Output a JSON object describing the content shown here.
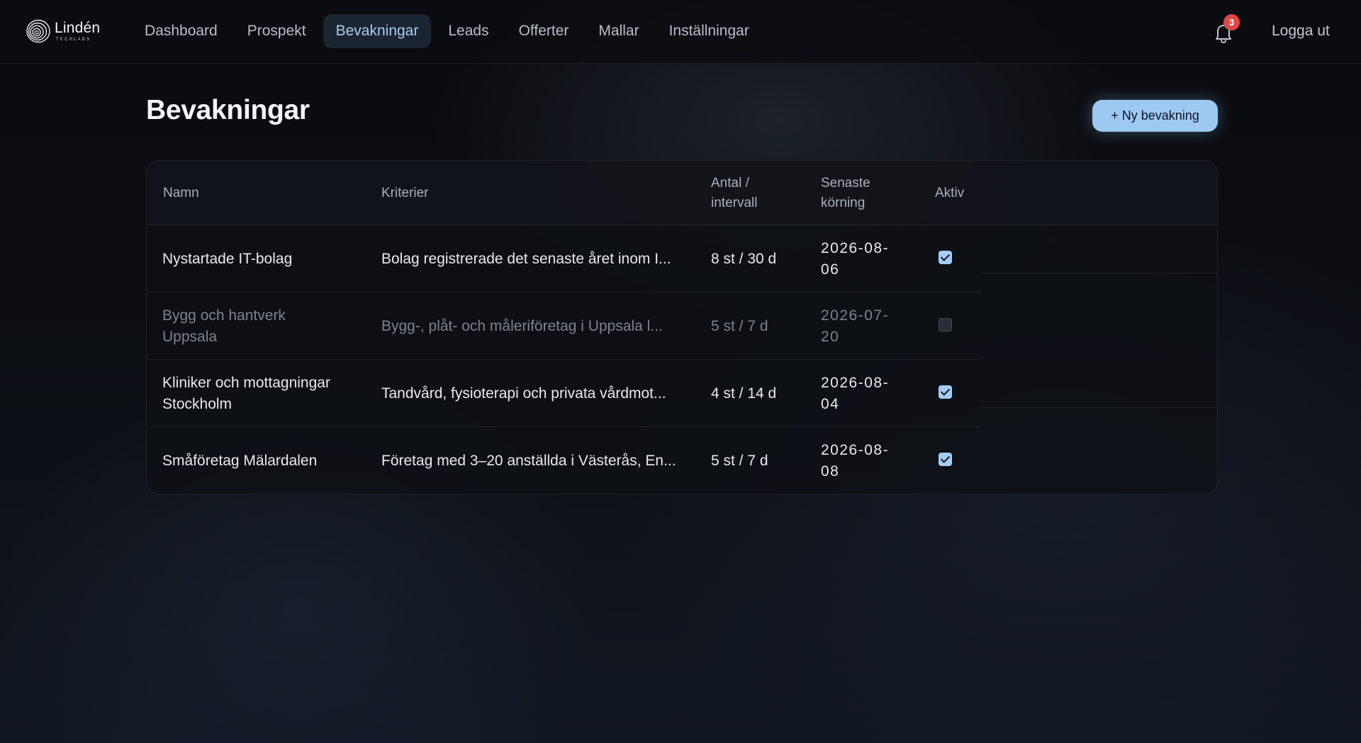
{
  "brand": {
    "name": "Lindén",
    "sub": "TECHLABS"
  },
  "nav": {
    "items": [
      {
        "label": "Dashboard",
        "active": false
      },
      {
        "label": "Prospekt",
        "active": false
      },
      {
        "label": "Bevakningar",
        "active": true
      },
      {
        "label": "Leads",
        "active": false
      },
      {
        "label": "Offerter",
        "active": false
      },
      {
        "label": "Mallar",
        "active": false
      },
      {
        "label": "Inställningar",
        "active": false
      }
    ],
    "notifications": {
      "icon": "bell-icon",
      "count": "3"
    },
    "logout_label": "Logga ut"
  },
  "page": {
    "title": "Bevakningar",
    "new_button_label": "+ Ny bevakning"
  },
  "table": {
    "columns": {
      "name": "Namn",
      "criteria": "Kriterier",
      "count_line1": "Antal /",
      "count_line2": "intervall",
      "last_line1": "Senaste",
      "last_line2": "körning",
      "active": "Aktiv"
    },
    "rows": [
      {
        "name": "Nystartade IT-bolag",
        "criteria": "Bolag registrerade det senaste året inom I...",
        "count": "8 st / 30 d",
        "date_line1": "2026-08-",
        "date_line2": "06",
        "active": true
      },
      {
        "name": "Bygg och hantverk Uppsala",
        "criteria": "Bygg-, plåt- och måleriföretag i Uppsala l...",
        "count": "5 st / 7 d",
        "date_line1": "2026-07-",
        "date_line2": "20",
        "active": false
      },
      {
        "name": "Kliniker och mottagningar Stockholm",
        "criteria": "Tandvård, fysioterapi och privata vårdmot...",
        "count": "4 st / 14 d",
        "date_line1": "2026-08-",
        "date_line2": "04",
        "active": true
      },
      {
        "name": "Småföretag Mälardalen",
        "criteria": "Företag med 3–20 anställda i Västerås, En...",
        "count": "5 st / 7 d",
        "date_line1": "2026-08-",
        "date_line2": "08",
        "active": true
      }
    ]
  },
  "colors": {
    "accent": "#9dc8f2",
    "badge": "#e04848",
    "nav_active_bg": "#1b2431"
  }
}
